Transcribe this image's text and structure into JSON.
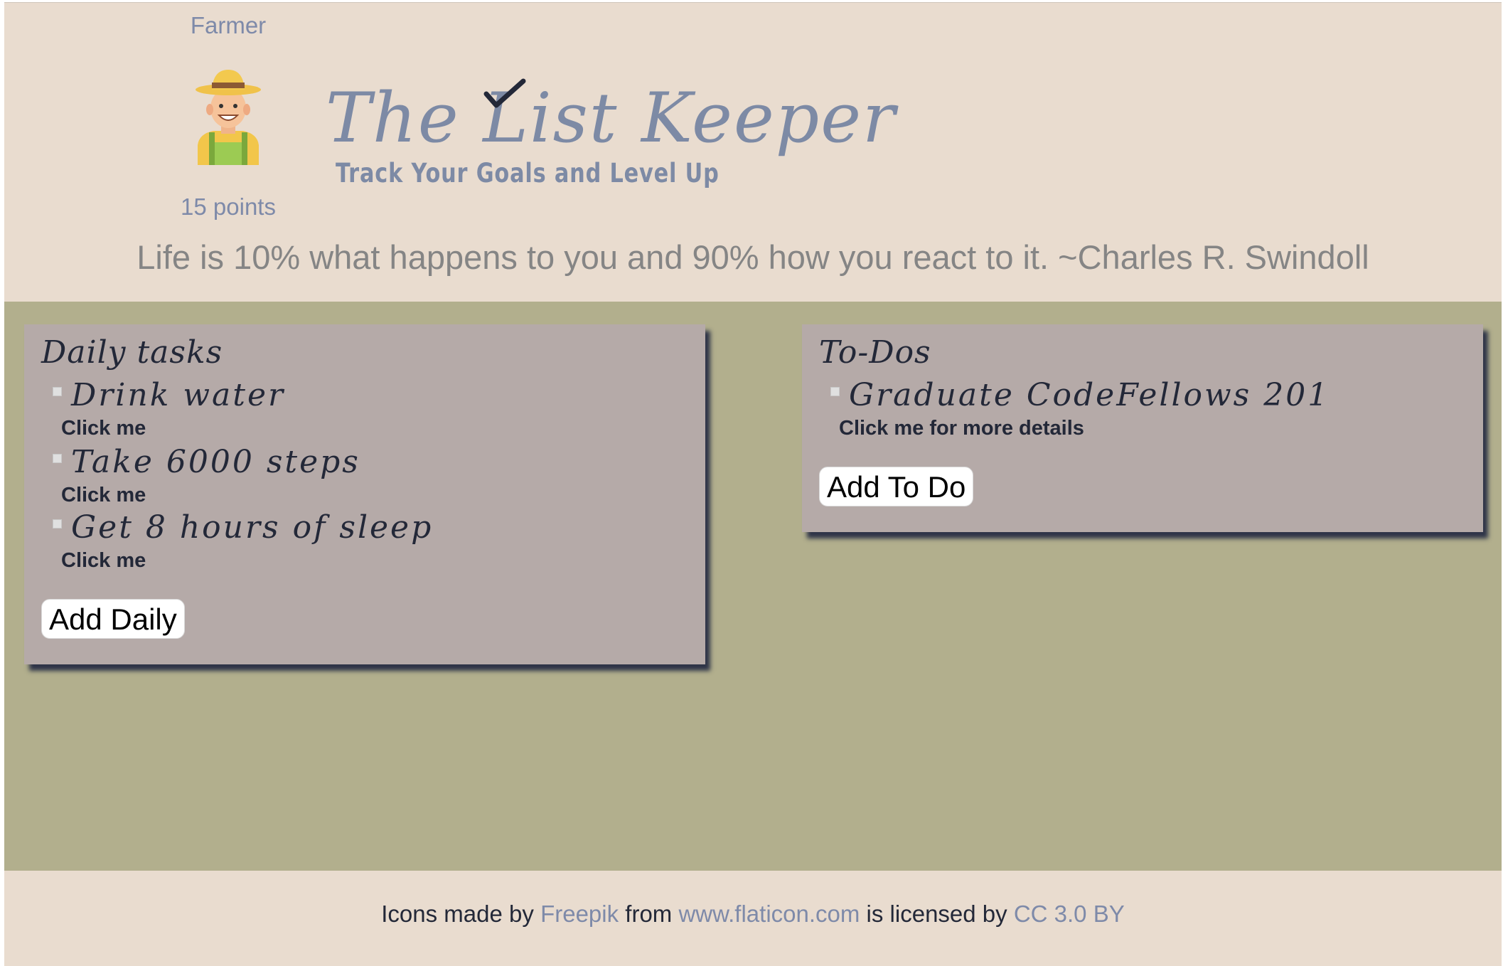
{
  "header": {
    "avatar_name": "Farmer",
    "points": "15 points",
    "logo_title": "The List Keeper",
    "logo_subtitle": "Track Your Goals and Level Up",
    "quote": "Life is 10% what happens to you and 90% how you react to it. ~Charles R. Swindoll"
  },
  "daily": {
    "title": "Daily tasks",
    "items": [
      {
        "title": "Drink water",
        "link": "Click me"
      },
      {
        "title": "Take 6000 steps",
        "link": "Click me"
      },
      {
        "title": "Get 8 hours of sleep",
        "link": "Click me"
      }
    ],
    "add_label": "Add Daily"
  },
  "todos": {
    "title": "To-Dos",
    "items": [
      {
        "title": "Graduate CodeFellows 201",
        "link": "Click me for more details"
      }
    ],
    "add_label": "Add To Do"
  },
  "footer": {
    "text1": "Icons made by",
    "link1": "Freepik",
    "text2": "from",
    "link2": "www.flaticon.com",
    "text3": "is licensed by",
    "link3": "CC 3.0 BY"
  },
  "colors": {
    "header_bg": "#e9dccf",
    "main_bg": "#b2af8d",
    "card_bg": "#b5aaa8",
    "accent_text": "#7e8aa9",
    "dark_text": "#232838"
  },
  "icons": {
    "avatar": "farmer-avatar-icon",
    "logo_mark": "checkmark-icon",
    "bullet": "square-bullet-icon"
  }
}
